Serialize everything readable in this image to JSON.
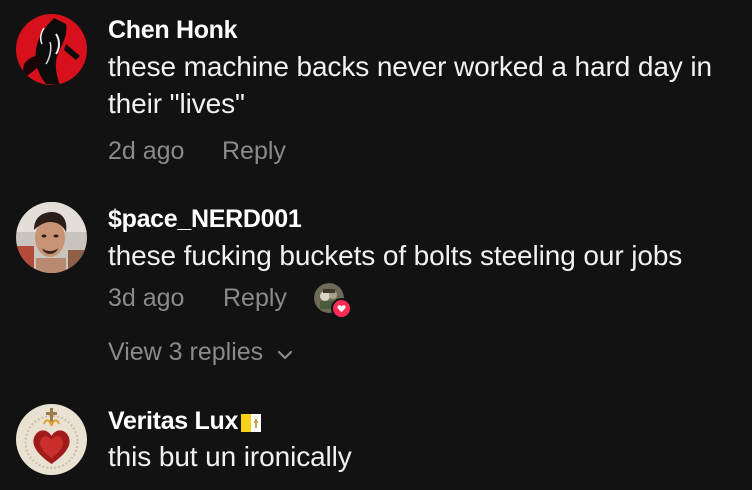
{
  "comments": [
    {
      "username": "Chen Honk",
      "text": "these machine backs never worked a hard day in their \"lives\"",
      "time": "2d ago",
      "reply_label": "Reply"
    },
    {
      "username": "$pace_NERD001",
      "text": "these fucking buckets of bolts steeling our jobs",
      "time": "3d ago",
      "reply_label": "Reply",
      "view_replies": "View 3 replies"
    },
    {
      "username": "Veritas Lux",
      "text": "this but un ironically"
    }
  ],
  "colors": {
    "background": "#121212",
    "secondary_text": "#8a8a8a",
    "like_heart": "#fe2c55"
  }
}
